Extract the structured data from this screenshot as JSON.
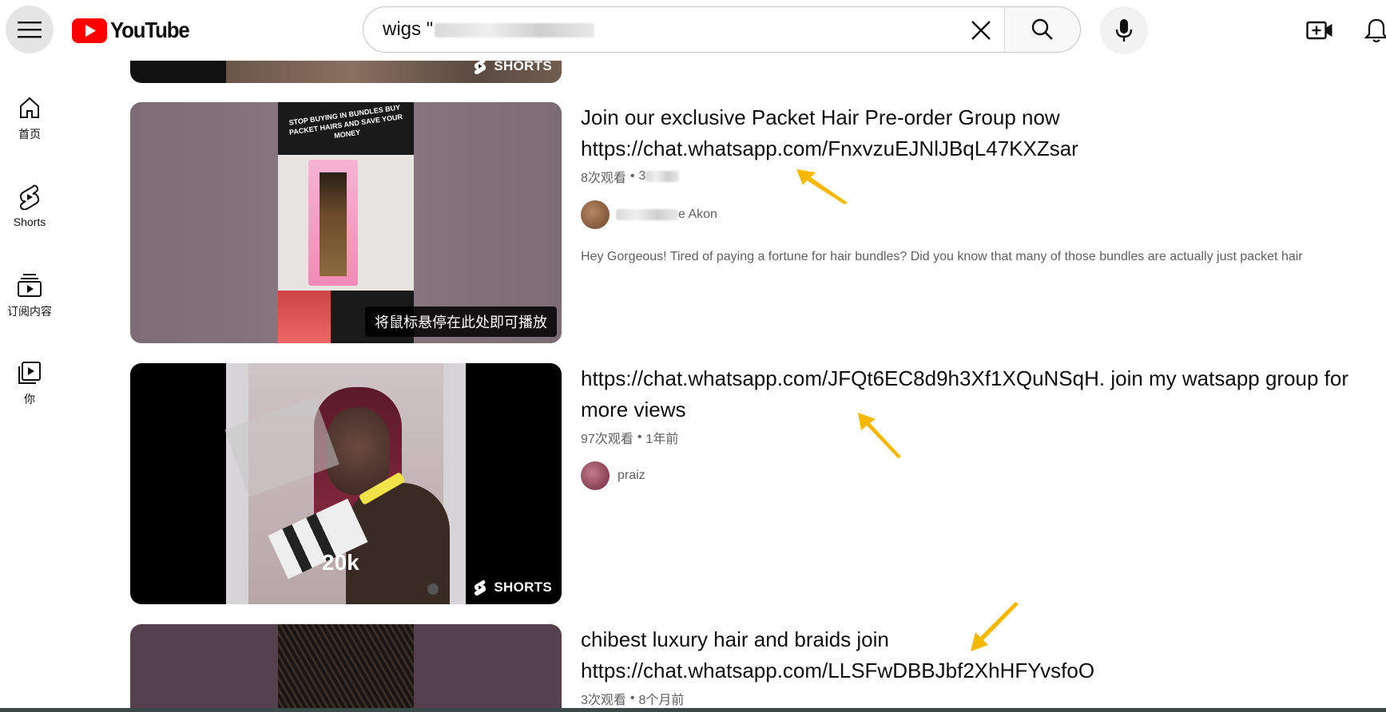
{
  "header": {
    "logo_text": "YouTube",
    "search_value": "wigs \"",
    "icons": [
      "menu-icon",
      "youtube-logo-icon",
      "clear-icon",
      "search-icon",
      "microphone-icon",
      "create-video-icon",
      "bell-icon"
    ]
  },
  "sidebar": {
    "items": [
      {
        "label": "首页",
        "icon": "home-icon"
      },
      {
        "label": "Shorts",
        "icon": "shorts-icon"
      },
      {
        "label": "订阅内容",
        "icon": "subscriptions-icon"
      },
      {
        "label": "你",
        "icon": "you-icon"
      }
    ]
  },
  "results": [
    {
      "badge": "SHORTS"
    },
    {
      "title_line1": "Join our exclusive Packet Hair Pre-order Group now",
      "title_line2": "https://chat.whatsapp.com/FnxvzuEJNlJBqL47KXZsar",
      "views": "8次观看",
      "age": "3",
      "channel": "e Akon",
      "description": "Hey Gorgeous! Tired of paying a fortune for hair bundles? Did you know that many of those bundles are actually just packet hair",
      "thumb_text": "STOP BUYING IN BUNDLES BUY PACKET HAIRS AND SAVE YOUR MONEY",
      "hover_tip": "将鼠标悬停在此处即可播放"
    },
    {
      "title_line1": "https://chat.whatsapp.com/JFQt6EC8d9h3Xf1XQuNSqH. join my watsapp group for",
      "title_line2": "more views",
      "views": "97次观看",
      "age": "1年前",
      "channel": "praiz",
      "thumb_views": "20k",
      "badge": "SHORTS"
    },
    {
      "title_line1": "chibest luxury hair and braids join",
      "title_line2": "https://chat.whatsapp.com/LLSFwDBBJbf2XhHFYvsfoO",
      "views": "3次观看",
      "age": "8个月前"
    }
  ],
  "colors": {
    "arrow": "#f5b800",
    "youtube_red": "#ff0000",
    "meta_grey": "#606060"
  }
}
